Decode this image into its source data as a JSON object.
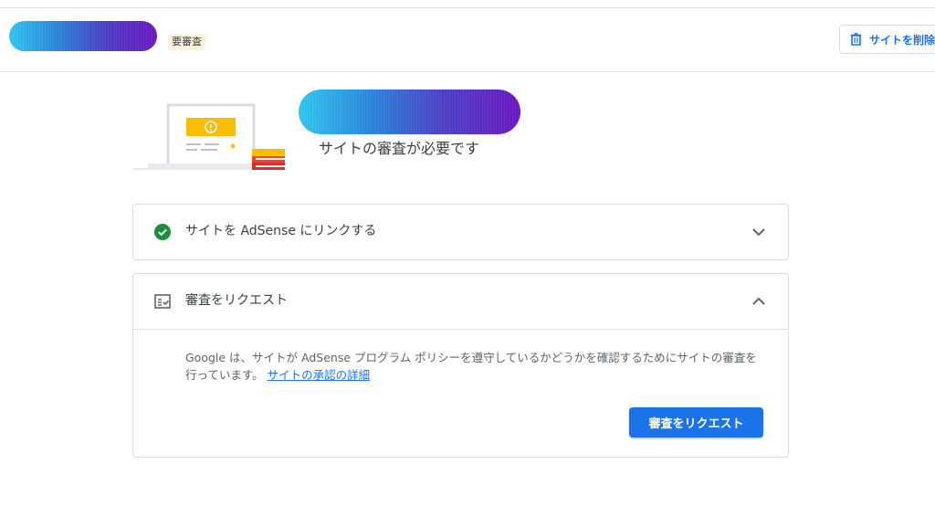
{
  "header": {
    "status_badge": "要審査",
    "delete_button_label": "サイトを削除"
  },
  "hero": {
    "subtitle": "サイトの審査が必要です"
  },
  "steps": [
    {
      "label": "サイトを AdSense にリンクする",
      "status": "complete",
      "expanded": false
    },
    {
      "label": "審査をリクエスト",
      "expanded": true,
      "description": "Google は、サイトが AdSense プログラム ポリシーを遵守しているかどうかを確認するためにサイトの審査を行っています。",
      "link_text": "サイトの承認の詳細",
      "button_label": "審査をリクエスト"
    }
  ],
  "colors": {
    "accent": "#1a73e8",
    "success": "#1e8e3e",
    "badge_bg": "#fdf3dc"
  },
  "icons": {
    "delete": "trash-icon",
    "step1": "check-circle-icon",
    "step2": "fact-check-icon",
    "collapsed": "chevron-down-icon",
    "expanded": "chevron-up-icon"
  }
}
